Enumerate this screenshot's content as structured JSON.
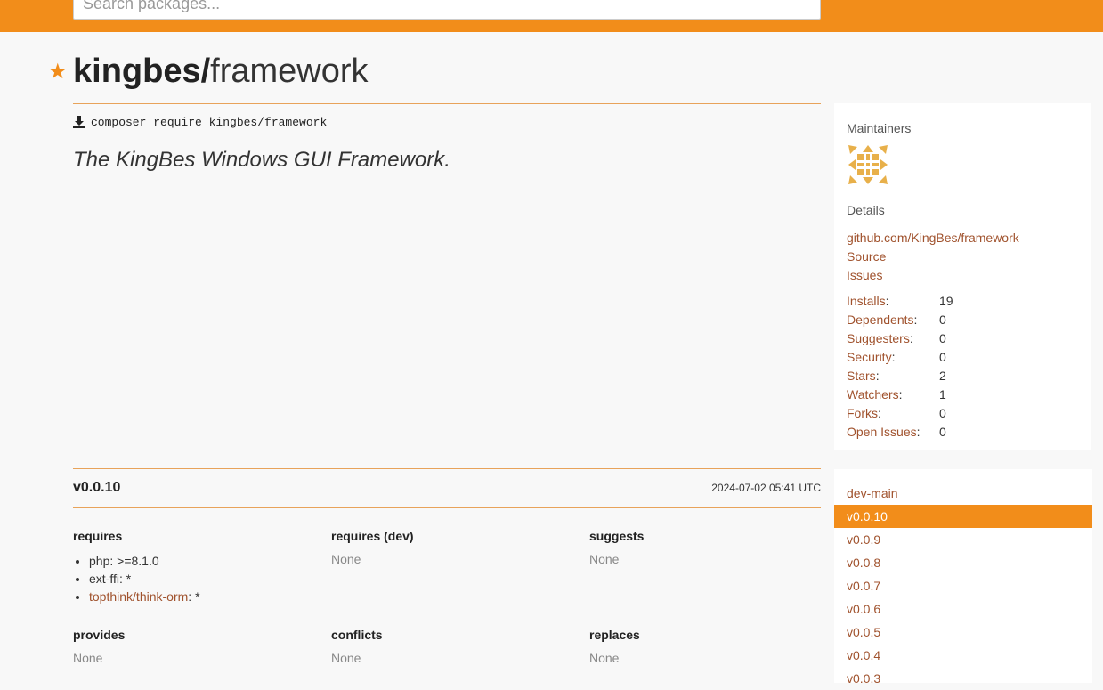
{
  "search": {
    "placeholder": "Search packages..."
  },
  "package": {
    "vendor": "kingbes/",
    "name": "framework",
    "install_command": "composer require kingbes/framework",
    "description": "The KingBes Windows GUI Framework."
  },
  "sidebar": {
    "maintainers_title": "Maintainers",
    "details_title": "Details",
    "links": [
      "github.com/KingBes/framework",
      "Source",
      "Issues"
    ],
    "stats": [
      {
        "label": "Installs",
        "value": "19"
      },
      {
        "label": "Dependents",
        "value": "0"
      },
      {
        "label": "Suggesters",
        "value": "0"
      },
      {
        "label": "Security",
        "value": "0"
      },
      {
        "label": "Stars",
        "value": "2"
      },
      {
        "label": "Watchers",
        "value": "1"
      },
      {
        "label": "Forks",
        "value": "0"
      },
      {
        "label": "Open Issues",
        "value": "0"
      }
    ]
  },
  "version": {
    "name": "v0.0.10",
    "date": "2024-07-02 05:41 UTC",
    "requires_title": "requires",
    "requires": [
      {
        "name": "php",
        "constraint": ">=8.1.0",
        "link": false
      },
      {
        "name": "ext-ffi",
        "constraint": "*",
        "link": false
      },
      {
        "name": "topthink/think-orm",
        "constraint": "*",
        "link": true
      }
    ],
    "requires_dev_title": "requires (dev)",
    "requires_dev": "None",
    "suggests_title": "suggests",
    "suggests": "None",
    "provides_title": "provides",
    "provides": "None",
    "conflicts_title": "conflicts",
    "conflicts": "None",
    "replaces_title": "replaces",
    "replaces": "None"
  },
  "versions_list": [
    "dev-main",
    "v0.0.10",
    "v0.0.9",
    "v0.0.8",
    "v0.0.7",
    "v0.0.6",
    "v0.0.5",
    "v0.0.4",
    "v0.0.3"
  ],
  "versions_active": "v0.0.10",
  "colors": {
    "accent": "#f28d1a",
    "link": "#a0522d"
  },
  "icons": {
    "star": "star-icon",
    "download": "download-icon"
  }
}
